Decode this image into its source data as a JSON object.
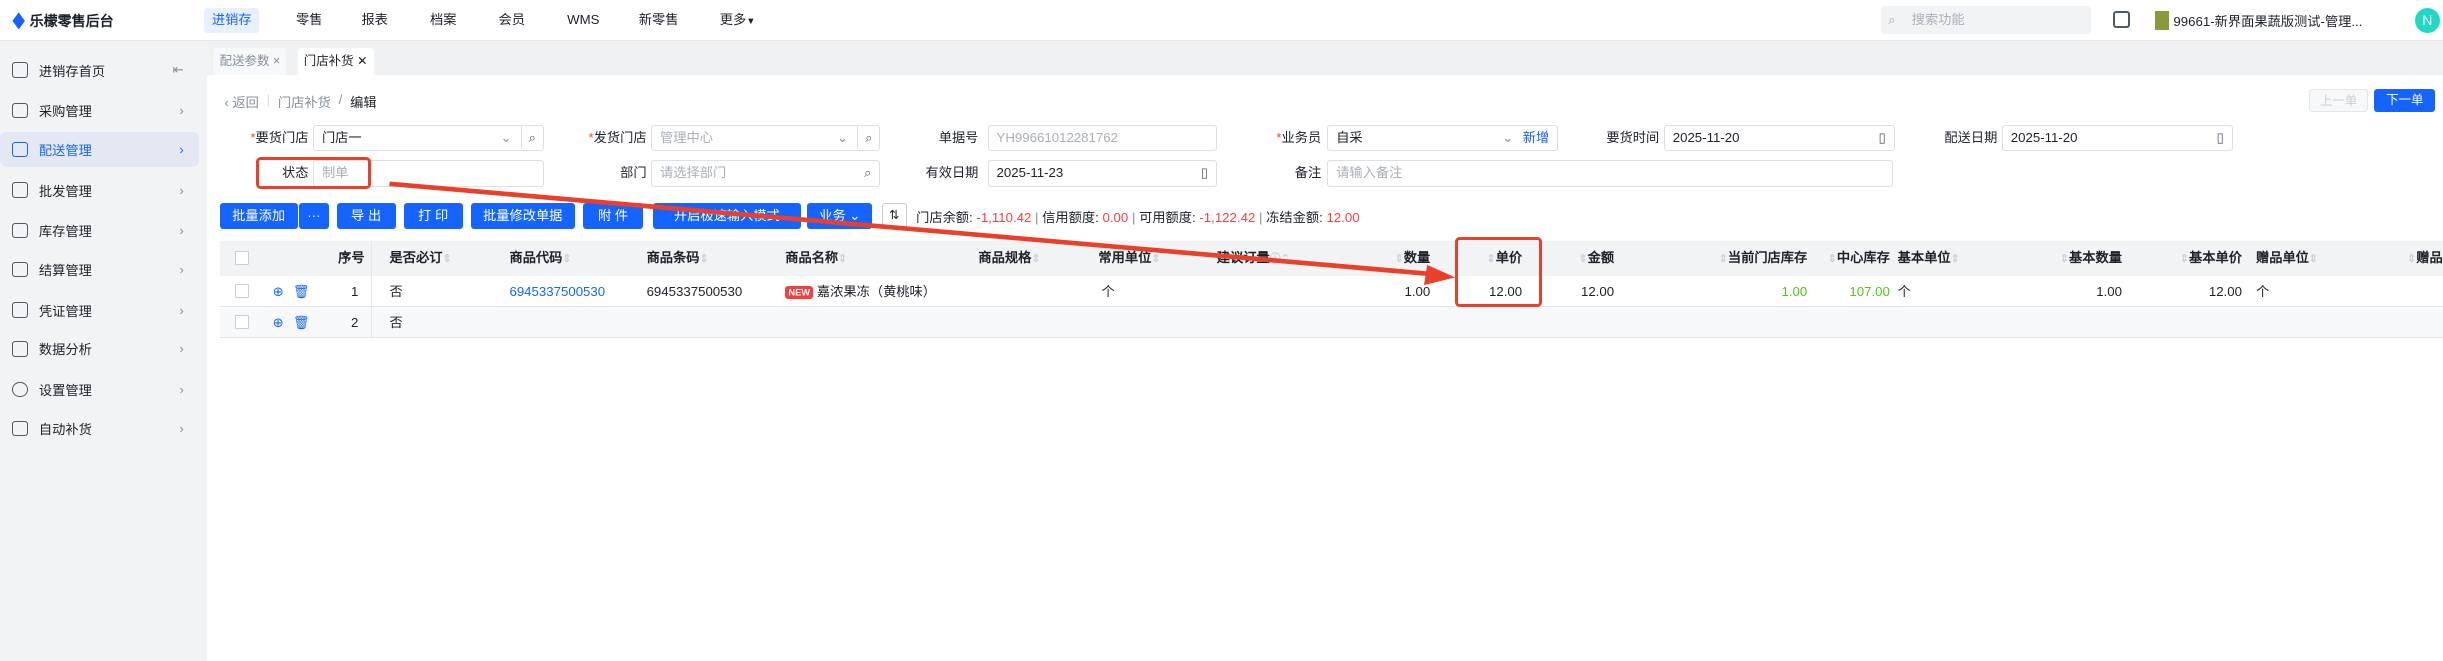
{
  "app": {
    "name": "乐檬零售后台"
  },
  "topnav": {
    "items": [
      "进销存",
      "零售",
      "报表",
      "档案",
      "会员",
      "WMS",
      "新零售",
      "更多"
    ],
    "active": "进销存",
    "search_placeholder": "搜索功能",
    "store": "99661-新界面果蔬版测试-管理...",
    "avatar": "N"
  },
  "sidebar": {
    "items": [
      "进销存首页",
      "采购管理",
      "配送管理",
      "批发管理",
      "库存管理",
      "结算管理",
      "凭证管理",
      "数据分析",
      "设置管理",
      "自动补货"
    ],
    "active": "配送管理"
  },
  "tabs": [
    {
      "label": "配送参数"
    },
    {
      "label": "门店补货"
    }
  ],
  "breadcrumb": {
    "back": "返回",
    "parent": "门店补货",
    "current": "编辑"
  },
  "pager": {
    "prev": "上一单",
    "next": "下一单"
  },
  "form": {
    "req_store_label": "要货门店",
    "req_store": "门店一",
    "ship_store_label": "发货门店",
    "ship_store_placeholder": "管理中心",
    "doc_no_label": "单据号",
    "doc_no": "YH99661012281762",
    "salesman_label": "业务员",
    "salesman": "自采",
    "add_new": "新增",
    "req_time_label": "要货时间",
    "req_time": "2025-11-20",
    "ship_date_label": "配送日期",
    "ship_date": "2025-11-20",
    "status_label": "状态",
    "status": "制单",
    "dept_label": "部门",
    "dept_placeholder": "请选择部门",
    "valid_date_label": "有效日期",
    "valid_date": "2025-11-23",
    "remark_label": "备注",
    "remark_placeholder": "请输入备注"
  },
  "toolbar": {
    "batch_add": "批量添加",
    "more": "···",
    "export": "导 出",
    "print": "打 印",
    "batch_edit": "批量修改单据",
    "attach": "附 件",
    "fast_mode": "开启极速输入模式",
    "business": "业务"
  },
  "balance": {
    "store_balance_label": "门店余额:",
    "store_balance": "-1,110.42",
    "credit_label": "信用额度:",
    "credit": "0.00",
    "available_label": "可用额度:",
    "available": "-1,122.42",
    "frozen_label": "冻结金额:",
    "frozen": "12.00"
  },
  "table": {
    "headers": [
      "序号",
      "是否必订",
      "商品代码",
      "商品条码",
      "商品名称",
      "商品规格",
      "常用单位",
      "建议订量",
      "数量",
      "单价",
      "金额",
      "当前门店库存",
      "中心库存",
      "基本单位",
      "基本数量",
      "基本单价",
      "赠品单位",
      "赠品"
    ],
    "rows": [
      {
        "no": "1",
        "must": "否",
        "code": "6945337500530",
        "barcode": "6945337500530",
        "badge": "NEW",
        "name": "嘉浓果冻（黄桃味）",
        "unit": "个",
        "qty": "1.00",
        "price": "12.00",
        "amount": "12.00",
        "store_stock": "1.00",
        "center_stock": "107.00",
        "base_unit": "个",
        "base_qty": "1.00",
        "base_price": "12.00",
        "gift_unit": "个"
      },
      {
        "no": "2",
        "must": "否"
      }
    ]
  },
  "colors": {
    "accent": "#1664ff",
    "annotation": "#e8402a",
    "negative": "#f53f3f",
    "stock": "#52c41a"
  }
}
